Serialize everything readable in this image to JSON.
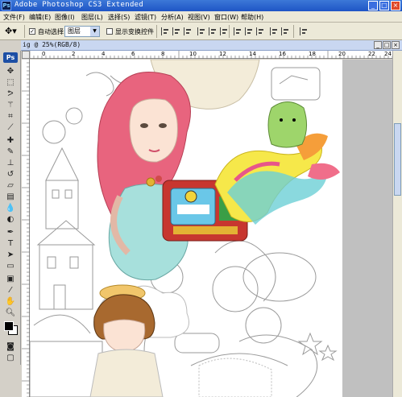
{
  "window": {
    "title": "Adobe Photoshop CS3 Extended",
    "app_icon": "Ps"
  },
  "window_buttons": {
    "minimize": "_",
    "maximize": "□",
    "close": "×"
  },
  "menu": [
    "文件(F)",
    "编辑(E)",
    "图像(I)",
    "图层(L)",
    "选择(S)",
    "滤镜(T)",
    "分析(A)",
    "视图(V)",
    "窗口(W)",
    "帮助(H)"
  ],
  "options": {
    "auto_select_label": "自动选择:",
    "auto_select_checked": "✓",
    "auto_select_value": "图层",
    "show_transform_label": "显示变换控件"
  },
  "document": {
    "tab_title": "ig @ 25%(RGB/8)"
  },
  "toolbox": {
    "logo": "Ps"
  },
  "rulers": {
    "h_numbers": [
      "0",
      "2",
      "4",
      "6",
      "8",
      "10",
      "12",
      "14",
      "16",
      "18",
      "20",
      "22",
      "24"
    ]
  },
  "colors": {
    "title_bar": "#2a63d2",
    "hair": "#e8647e",
    "skin": "#fbe3d4",
    "dress": "#a7e0dc"
  }
}
